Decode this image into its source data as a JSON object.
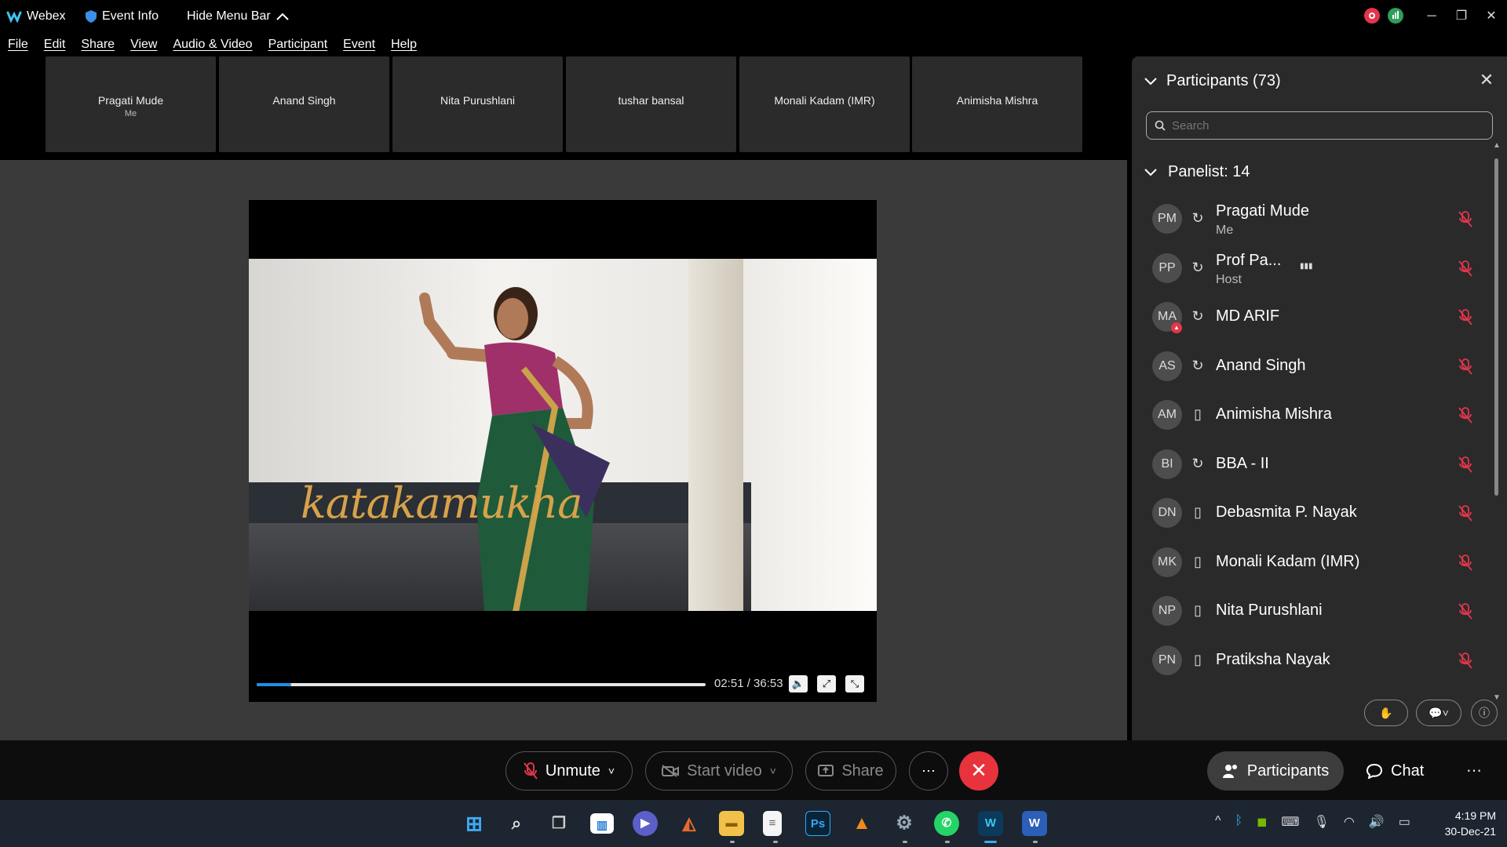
{
  "titlebar": {
    "app_name": "Webex",
    "event_info": "Event Info",
    "hide_menu_bar": "Hide Menu Bar"
  },
  "menu": [
    "File",
    "Edit",
    "Share",
    "View",
    "Audio & Video",
    "Participant",
    "Event",
    "Help"
  ],
  "thumbnails": [
    {
      "name": "Pragati Mude",
      "sub": "Me"
    },
    {
      "name": "Anand Singh",
      "sub": ""
    },
    {
      "name": "Nita Purushlani",
      "sub": ""
    },
    {
      "name": "tushar bansal",
      "sub": ""
    },
    {
      "name": "Monali Kadam (IMR)",
      "sub": ""
    },
    {
      "name": "Animisha Mishra",
      "sub": ""
    }
  ],
  "video": {
    "caption": "katakamukha",
    "timecode": "02:51 / 36:53",
    "progress_fraction": 0.0776
  },
  "panel": {
    "title": "Participants (73)",
    "search_placeholder": "Search",
    "panelist_header": "Panelist: 14",
    "participants": [
      {
        "initials": "PM",
        "name": "Pragati Mude",
        "sub": "Me",
        "device": "headset"
      },
      {
        "initials": "PP",
        "name": "Prof Pa...",
        "sub": "Host",
        "device": "headset",
        "speaking": true
      },
      {
        "initials": "MA",
        "name": "MD ARIF",
        "sub": "",
        "device": "headset",
        "badge": true
      },
      {
        "initials": "AS",
        "name": "Anand Singh",
        "sub": "",
        "device": "headset"
      },
      {
        "initials": "AM",
        "name": "Animisha Mishra",
        "sub": "",
        "device": "phone"
      },
      {
        "initials": "BI",
        "name": "BBA - II",
        "sub": "",
        "device": "headset"
      },
      {
        "initials": "DN",
        "name": "Debasmita P. Nayak",
        "sub": "",
        "device": "phone"
      },
      {
        "initials": "MK",
        "name": "Monali Kadam (IMR)",
        "sub": "",
        "device": "phone"
      },
      {
        "initials": "NP",
        "name": "Nita Purushlani",
        "sub": "",
        "device": "phone"
      },
      {
        "initials": "PN",
        "name": "Pratiksha Nayak",
        "sub": "",
        "device": "phone"
      }
    ]
  },
  "controls": {
    "unmute": "Unmute",
    "start_video": "Start video",
    "share": "Share",
    "participants": "Participants",
    "chat": "Chat"
  },
  "taskbar": {
    "time": "4:19 PM",
    "date": "30-Dec-21"
  },
  "colors": {
    "accent": "#1f8fe8",
    "end_call": "#e8323c",
    "mute_red": "#e2364c",
    "panel_bg": "#2a2a2a"
  }
}
